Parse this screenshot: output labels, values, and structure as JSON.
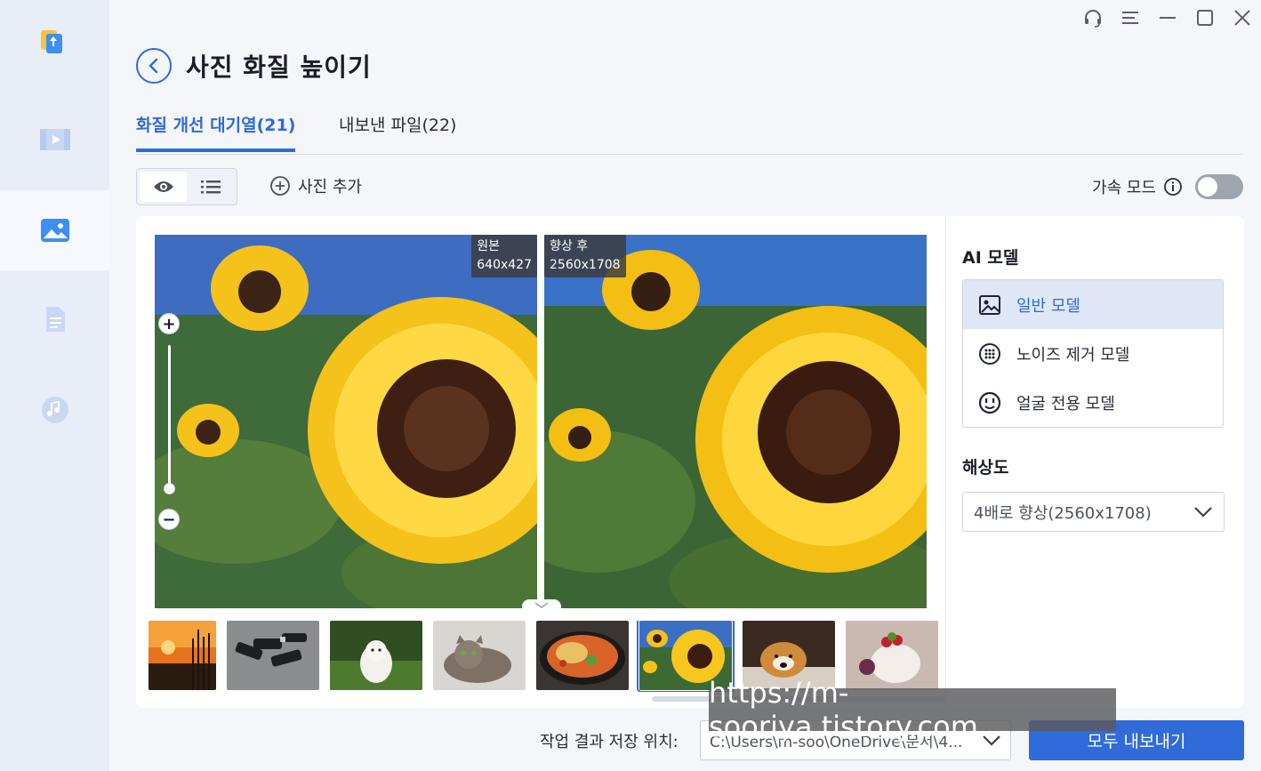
{
  "page": {
    "title": "사진 화질 높이기"
  },
  "tabs": [
    {
      "label": "화질 개선 대기열(21)"
    },
    {
      "label": "내보낸 파일(22)"
    }
  ],
  "toolbar": {
    "add_photo_label": "사진 추가",
    "accel_label": "가속 모드"
  },
  "preview": {
    "original_label": "원본",
    "original_size": "640x427",
    "enhanced_label": "향상 후",
    "enhanced_size": "2560x1708",
    "zoom_in": "+",
    "zoom_out": "−"
  },
  "right_panel": {
    "ai_model_title": "AI 모델",
    "models": [
      {
        "label": "일반 모델"
      },
      {
        "label": "노이즈 제거 모델"
      },
      {
        "label": "얼굴 전용 모델"
      }
    ],
    "resolution_title": "해상도",
    "resolution_value": "4배로 향상(2560x1708)"
  },
  "bottom": {
    "save_location_label": "작업 결과 저장 위치:",
    "save_path": "C:\\Users\\m-soo\\OneDrive\\문서\\4...",
    "export_all_label": "모두 내보내기"
  },
  "watermark": "https://m-sooriya.tistory.com",
  "colors": {
    "accent": "#2f6bd9",
    "sidebar_bg": "#e8eef8",
    "main_bg": "#f4f6fa"
  }
}
